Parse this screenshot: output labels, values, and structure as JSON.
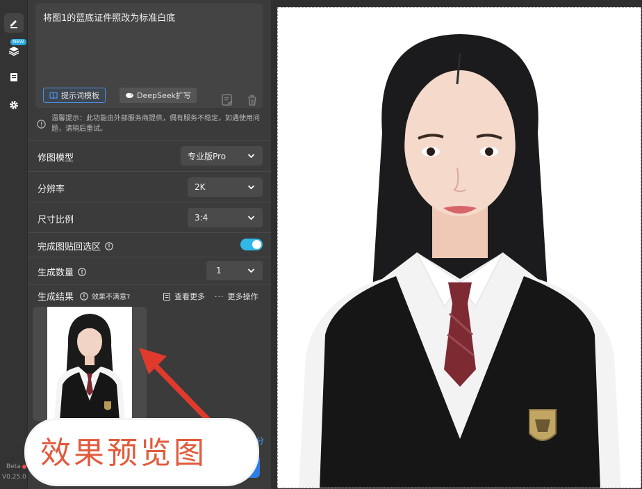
{
  "rail": {
    "new_badge": "NEW",
    "beta": "Beta",
    "version": "V0.25.0"
  },
  "prompt": {
    "text": "将图1的蓝底证件照改为标准白底",
    "template_button": "提示词模板",
    "deepseek_button": "DeepSeek扩写"
  },
  "hint": "温馨提示：此功能由外部服务商提供，偶有服务不稳定，如遇使用问题，请稍后重试。",
  "settings": {
    "model": {
      "label": "修图模型",
      "value": "专业版Pro"
    },
    "resolution": {
      "label": "分辨率",
      "value": "2K"
    },
    "ratio": {
      "label": "尺寸比例",
      "value": "3:4"
    },
    "paste_back": {
      "label": "完成图贴回选区",
      "enabled": true
    },
    "count": {
      "label": "生成数量",
      "value": "1"
    }
  },
  "results": {
    "label": "生成结果",
    "unsatisfied": "效果不满意?",
    "view_more": "查看更多",
    "more_ops": "更多操作"
  },
  "footer": {
    "fen_link": "分"
  },
  "callout": "效果预览图",
  "colors": {
    "accent": "#2fb8e8",
    "template_border": "#4a8fe7",
    "callout_text": "#e25a3c"
  }
}
